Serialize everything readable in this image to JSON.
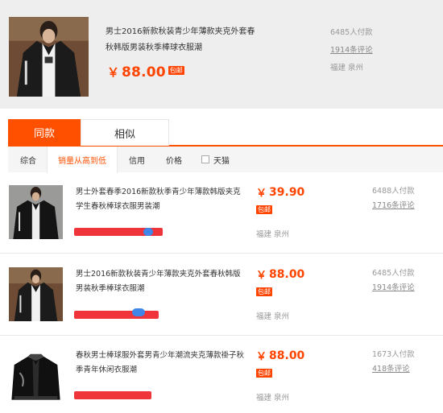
{
  "top_product": {
    "title": "男士2016新款秋装青少年薄款夹克外套春秋韩版男装秋季棒球衣服潮",
    "price_symbol": "￥",
    "price": "88.00",
    "badge": "包邮",
    "payers": "6485人付款",
    "reviews": "1914条评论",
    "location": "福建 泉州"
  },
  "tabs": [
    {
      "label": "同款",
      "active": true
    },
    {
      "label": "相似",
      "active": false
    }
  ],
  "sort": {
    "zonghe": "综合",
    "sales": "销量从高到低",
    "credit": "信用",
    "price": "价格",
    "tmall": "天猫"
  },
  "items": [
    {
      "title": "男士外套春季2016新款秋季青少年薄款韩版夹克学生春秋棒球衣服男装潮",
      "price": "39.90",
      "badge": "包邮",
      "location": "福建 泉州",
      "payers": "6488人付款",
      "reviews": "1716条评论"
    },
    {
      "title": "男士2016新款秋装青少年薄款夹克外套春秋韩版男装秋季棒球衣服潮",
      "price": "88.00",
      "badge": "包邮",
      "location": "福建 泉州",
      "payers": "6485人付款",
      "reviews": "1914条评论"
    },
    {
      "title": "春秋男士棒球服外套男青少年潮流夹克薄款褂子秋季青年休闲衣服潮",
      "price": "88.00",
      "badge": "包邮",
      "location": "福建 泉州",
      "payers": "1673人付款",
      "reviews": "418条评论"
    }
  ],
  "colors": {
    "accent": "#ff5000",
    "price": "#ff4400",
    "redaction": "#f0353a"
  }
}
